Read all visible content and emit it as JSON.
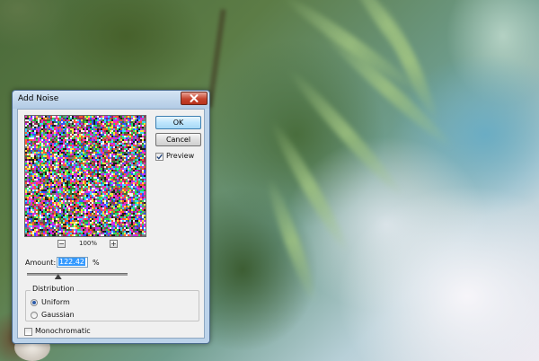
{
  "dialog": {
    "title": "Add Noise",
    "ok_label": "OK",
    "cancel_label": "Cancel",
    "preview_label": "Preview",
    "preview_checked": true,
    "zoom_minus": "−",
    "zoom_level": "100%",
    "zoom_plus": "+",
    "amount_label": "Amount:",
    "amount_value": "122.42",
    "amount_unit": "%",
    "amount_slider_fraction": 0.31,
    "distribution_title": "Distribution",
    "distribution_options": [
      "Uniform",
      "Gaussian"
    ],
    "distribution_selected": "Uniform",
    "monochromatic_label": "Monochromatic",
    "monochromatic_checked": false
  },
  "colors": {
    "title_bar": "#bcd3ea",
    "close_button": "#c6432c",
    "selection": "#3399ff",
    "ok_button": "#bee6fd"
  },
  "icons": {
    "close": "close-icon",
    "check": "checkmark-icon"
  }
}
